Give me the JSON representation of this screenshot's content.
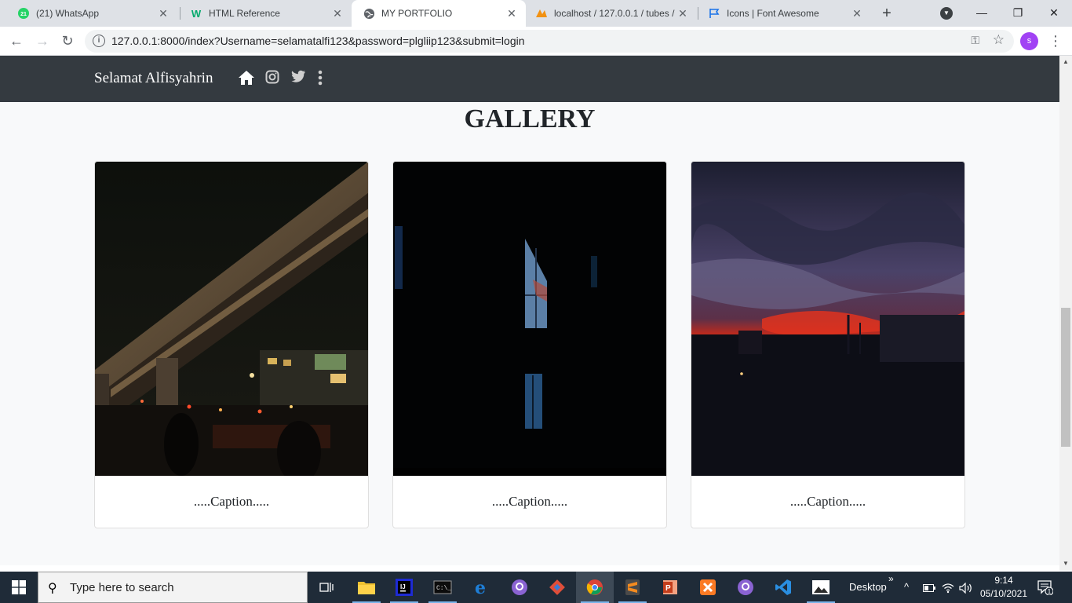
{
  "browser": {
    "tabs": [
      {
        "title": "(21) WhatsApp",
        "icon": "whatsapp-icon",
        "badge": "21"
      },
      {
        "title": "HTML Reference",
        "icon": "w3schools-icon"
      },
      {
        "title": "MY PORTFOLIO",
        "icon": "globe-icon"
      },
      {
        "title": "localhost / 127.0.0.1 / tubes /",
        "icon": "phpmyadmin-icon"
      },
      {
        "title": "Icons | Font Awesome",
        "icon": "flag-icon"
      }
    ],
    "active_tab": 2,
    "url": "127.0.0.1:8000/index?Username=selamatalfi123&password=plgliip123&submit=login",
    "profile_initial": "s",
    "profile_color": "#a142f4"
  },
  "site": {
    "brand": "Selamat Alfisyahrin",
    "nav_icons": [
      "home-icon",
      "instagram-icon",
      "twitter-icon",
      "more-vertical-icon"
    ],
    "navbar_color": "#343a40",
    "section_title": "GALLERY",
    "cards": [
      {
        "caption": ".....Caption.....",
        "photo": "flyover-night-photo"
      },
      {
        "caption": ".....Caption.....",
        "photo": "dark-window-photo"
      },
      {
        "caption": ".....Caption.....",
        "photo": "red-sunset-sky-photo"
      }
    ]
  },
  "taskbar": {
    "search_placeholder": "Type here to search",
    "desktop_label": "Desktop",
    "time": "9:14",
    "date": "05/10/2021",
    "notification_count": "1",
    "apps": [
      "task-view-icon",
      "file-explorer-icon",
      "intellij-icon",
      "terminal-icon",
      "edge-icon",
      "github-desktop-icon",
      "git-icon",
      "chrome-icon",
      "sublime-icon",
      "powerpoint-icon",
      "xampp-icon",
      "github-desktop-icon",
      "vscode-icon",
      "photos-icon"
    ]
  }
}
